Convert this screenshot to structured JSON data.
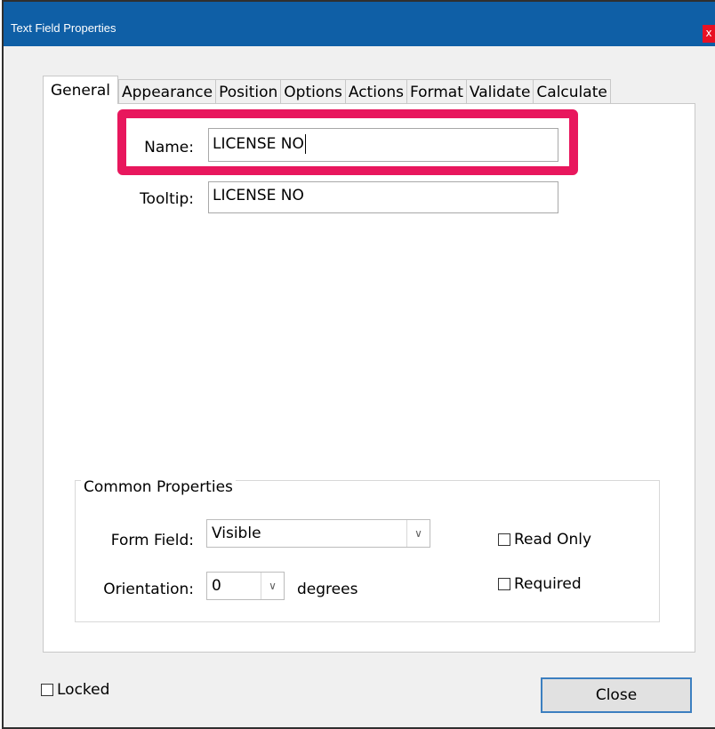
{
  "window": {
    "title": "Text Field Properties",
    "close_glyph": "x"
  },
  "tabs": [
    {
      "label": "General",
      "active": true
    },
    {
      "label": "Appearance",
      "active": false
    },
    {
      "label": "Position",
      "active": false
    },
    {
      "label": "Options",
      "active": false
    },
    {
      "label": "Actions",
      "active": false
    },
    {
      "label": "Format",
      "active": false
    },
    {
      "label": "Validate",
      "active": false
    },
    {
      "label": "Calculate",
      "active": false
    }
  ],
  "general": {
    "name_label": "Name:",
    "name_value": "LICENSE NO",
    "tooltip_label": "Tooltip:",
    "tooltip_value": "LICENSE NO",
    "highlight_color": "#e8175d"
  },
  "common": {
    "legend": "Common Properties",
    "form_field_label": "Form Field:",
    "form_field_value": "Visible",
    "orientation_label": "Orientation:",
    "orientation_value": "0",
    "orientation_units": "degrees",
    "read_only_label": "Read Only",
    "read_only_checked": false,
    "required_label": "Required",
    "required_checked": false
  },
  "footer": {
    "locked_label": "Locked",
    "locked_checked": false,
    "close_label": "Close"
  },
  "colors": {
    "titlebar": "#0f5fa6",
    "close_button": "#e81123",
    "accent_border": "#3c7fc0"
  }
}
